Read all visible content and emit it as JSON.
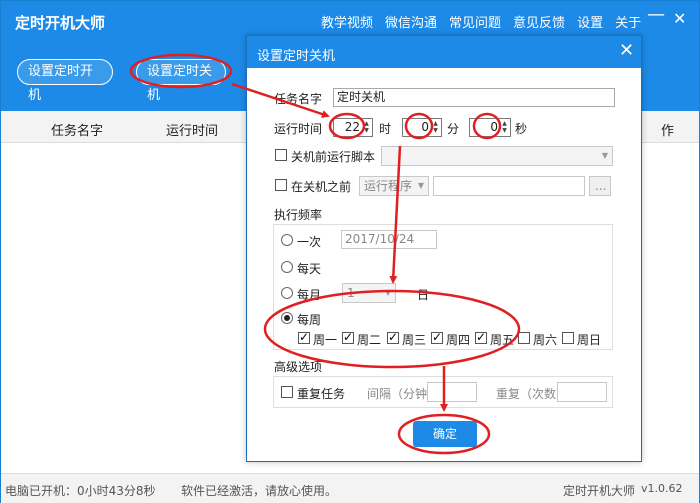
{
  "app": {
    "title": "定时开机大师",
    "nav": [
      "教学视频",
      "微信沟通",
      "常见问题",
      "意见反馈",
      "设置",
      "关于"
    ],
    "minimize_glyph": "—",
    "close_glyph": "✕",
    "btn_startup": "设置定时开机",
    "btn_shutdown": "设置定时关机",
    "columns": {
      "name": "任务名字",
      "time": "运行时间",
      "op": "作"
    },
    "status_left": "电脑已开机：0小时43分8秒",
    "status_mid": "软件已经激活，请放心使用。",
    "status_brand": "定时开机大师",
    "status_version": "v1.0.62",
    "accent": "#1c8ae6"
  },
  "dialog": {
    "title": "设置定时关机",
    "close_glyph": "✕",
    "task_name_label": "任务名字",
    "task_name_value": "定时关机",
    "run_time_label": "运行时间",
    "hour": "22",
    "hour_unit": "时",
    "minute": "0",
    "minute_unit": "分",
    "second": "0",
    "second_unit": "秒",
    "pre_script_label": "关机前运行脚本",
    "before_shutdown_label": "在关机之前",
    "run_program_label": "运行程序",
    "browse_label": "...",
    "frequency_label": "执行频率",
    "once_label": "一次",
    "once_date": "2017/10/24",
    "daily_label": "每天",
    "monthly_label": "每月",
    "monthly_day": "1",
    "monthly_day_unit": "日",
    "weekly_label": "每周",
    "weekdays": [
      {
        "label": "周一",
        "checked": true
      },
      {
        "label": "周二",
        "checked": true
      },
      {
        "label": "周三",
        "checked": true
      },
      {
        "label": "周四",
        "checked": true
      },
      {
        "label": "周五",
        "checked": true
      },
      {
        "label": "周六",
        "checked": false
      },
      {
        "label": "周日",
        "checked": false
      }
    ],
    "advanced_label": "高级选项",
    "repeat_task_label": "重复任务",
    "interval_label": "间隔（分钟）",
    "repeat_count_label": "重复（次数）",
    "ok_label": "确定"
  },
  "annotation": {
    "color": "#e02020"
  }
}
